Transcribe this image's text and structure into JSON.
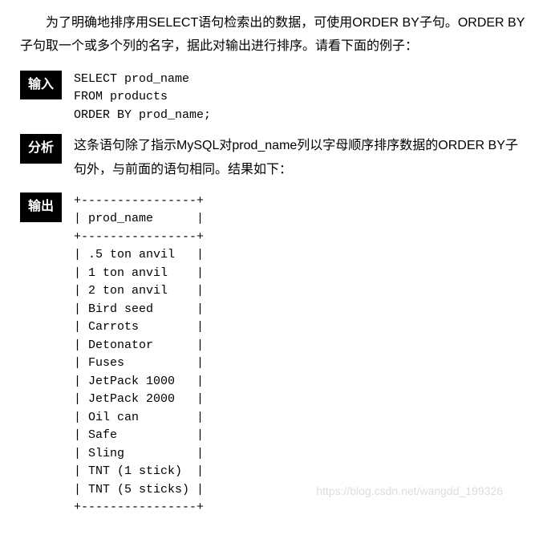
{
  "intro": "为了明确地排序用SELECT语句检索出的数据，可使用ORDER BY子句。ORDER BY子句取一个或多个列的名字，据此对输出进行排序。请看下面的例子：",
  "labels": {
    "input": "输入",
    "analysis": "分析",
    "output": "输出"
  },
  "code": "SELECT prod_name\nFROM products\nORDER BY prod_name;",
  "analysis": "这条语句除了指示MySQL对prod_name列以字母顺序排序数据的ORDER BY子句外，与前面的语句相同。结果如下：",
  "output_table": "+----------------+\n| prod_name      |\n+----------------+\n| .5 ton anvil   |\n| 1 ton anvil    |\n| 2 ton anvil    |\n| Bird seed      |\n| Carrots        |\n| Detonator      |\n| Fuses          |\n| JetPack 1000   |\n| JetPack 2000   |\n| Oil can        |\n| Safe           |\n| Sling          |\n| TNT (1 stick)  |\n| TNT (5 sticks) |\n+----------------+",
  "watermark": "https://blog.csdn.net/wangdd_199326"
}
